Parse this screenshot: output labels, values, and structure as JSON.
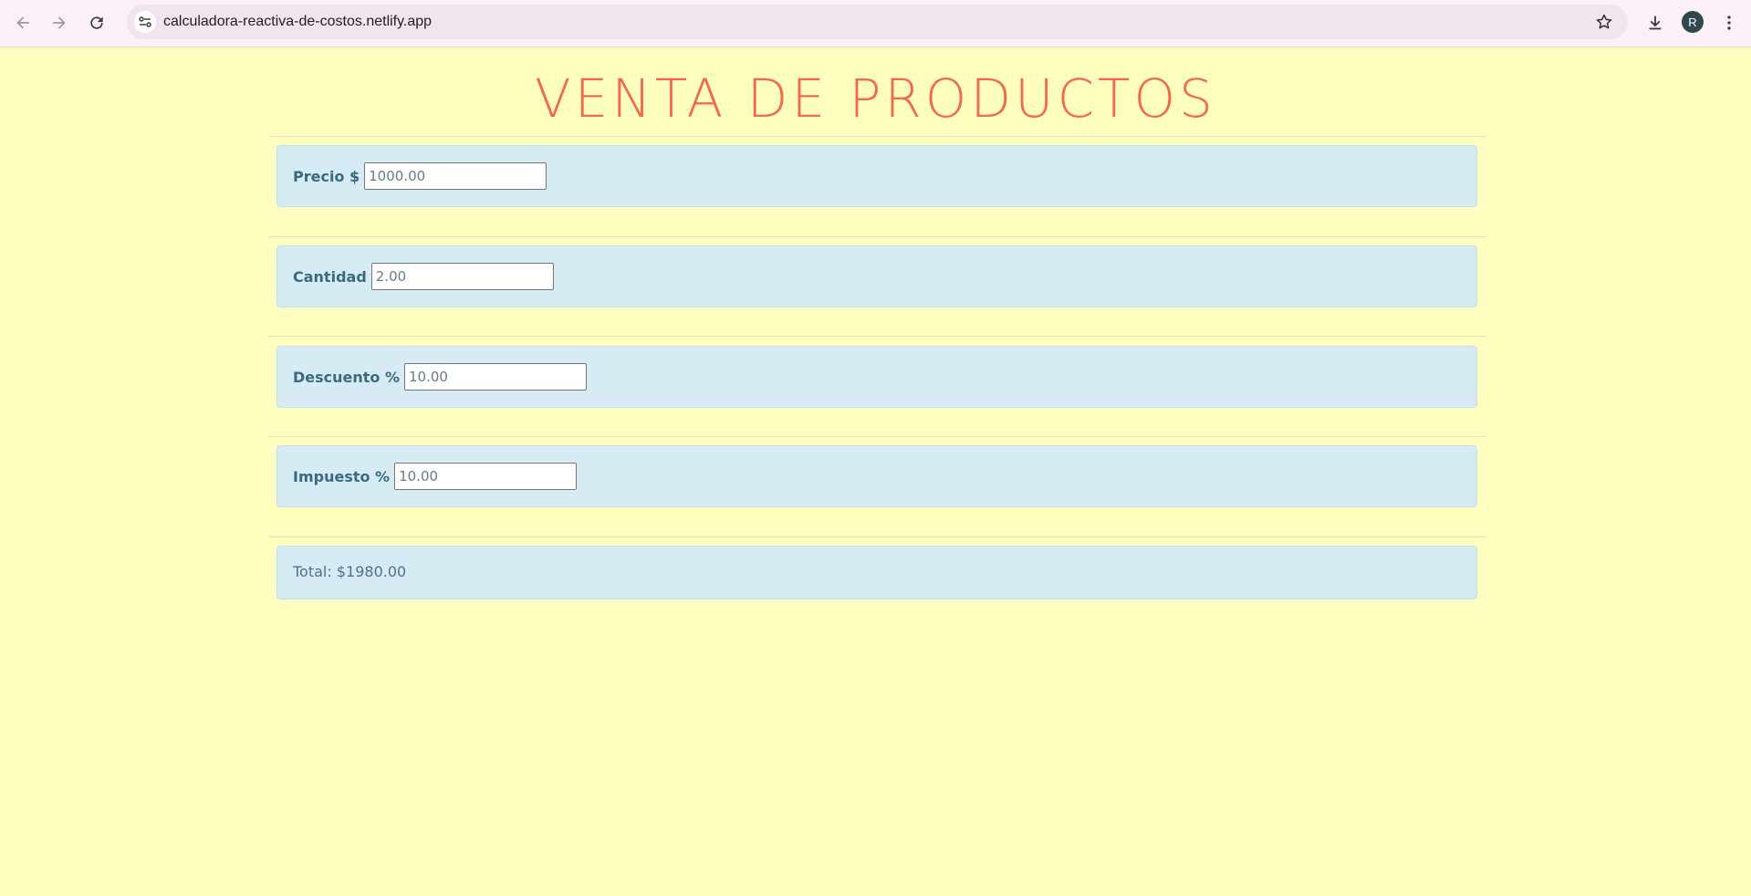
{
  "browser": {
    "url": "calculadora-reactiva-de-costos.netlify.app",
    "profile_initial": "R",
    "icons": [
      "back-icon",
      "forward-icon",
      "reload-icon",
      "site-settings-icon",
      "bookmark-star-icon",
      "download-icon",
      "more-menu-icon"
    ]
  },
  "page": {
    "title": "VENTA DE PRODUCTOS",
    "fields": [
      {
        "label": "Precio $",
        "value": "1000.00"
      },
      {
        "label": "Cantidad",
        "value": "2.00"
      },
      {
        "label": "Descuento %",
        "value": "10.00"
      },
      {
        "label": "Impuesto %",
        "value": "10.00"
      }
    ],
    "total": "Total: $1980.00"
  },
  "colors": {
    "background": "#ffffc0",
    "title": "#f4694b",
    "card": "#d7ebf4",
    "label": "#3a6a80"
  }
}
